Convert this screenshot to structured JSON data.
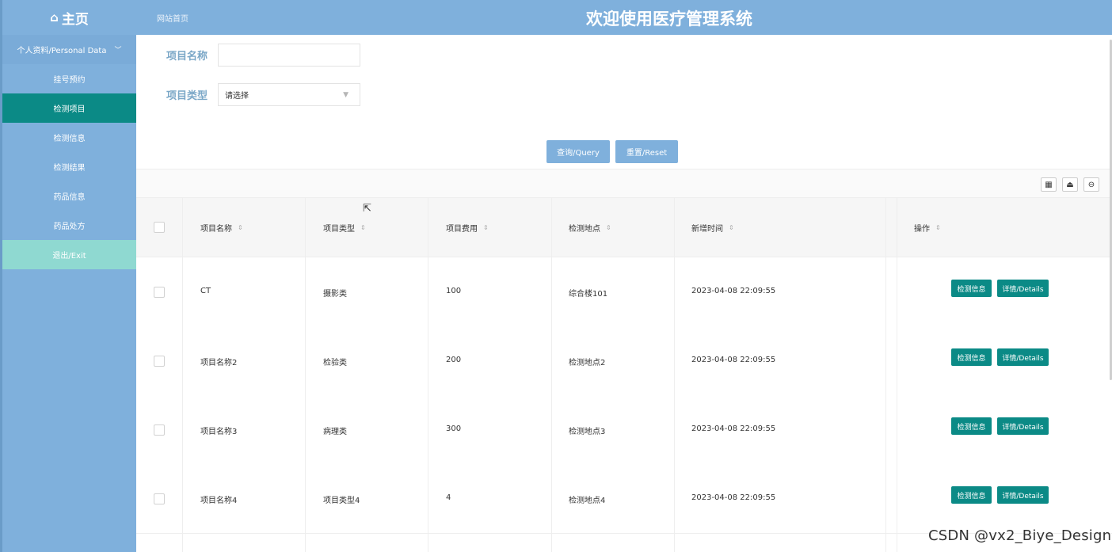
{
  "header": {
    "home_icon": "home-icon",
    "home_label": "主页",
    "breadcrumb": "网站首页",
    "title": "欢迎使用医疗管理系统"
  },
  "sidebar": {
    "group_label": "个人资料/Personal Data",
    "items": [
      {
        "label": "挂号预约"
      },
      {
        "label": "检测项目"
      },
      {
        "label": "检测信息"
      },
      {
        "label": "检测结果"
      },
      {
        "label": "药品信息"
      },
      {
        "label": "药品处方"
      },
      {
        "label": "退出/Exit"
      }
    ]
  },
  "search": {
    "name_label": "项目名称",
    "name_value": "",
    "type_label": "项目类型",
    "type_placeholder": "请选择",
    "query_button": "查询/Query",
    "reset_button": "重置/Reset"
  },
  "table": {
    "columns": [
      "项目名称",
      "项目类型",
      "项目费用",
      "检测地点",
      "新增时间",
      "操作"
    ],
    "rows": [
      {
        "name": "CT",
        "type": "摄影类",
        "fee": "100",
        "place": "综合楼101",
        "time": "2023-04-08 22:09:55"
      },
      {
        "name": "项目名称2",
        "type": "检验类",
        "fee": "200",
        "place": "检测地点2",
        "time": "2023-04-08 22:09:55"
      },
      {
        "name": "项目名称3",
        "type": "病理类",
        "fee": "300",
        "place": "检测地点3",
        "time": "2023-04-08 22:09:55"
      },
      {
        "name": "项目名称4",
        "type": "项目类型4",
        "fee": "4",
        "place": "检测地点4",
        "time": "2023-04-08 22:09:55"
      }
    ],
    "action_info": "检测信息",
    "action_details": "详情/Details"
  },
  "watermark": "CSDN @vx2_Biye_Design",
  "colors": {
    "accent": "#7fb0dc",
    "teal": "#0b8a86",
    "exit": "#8fd9d1"
  }
}
